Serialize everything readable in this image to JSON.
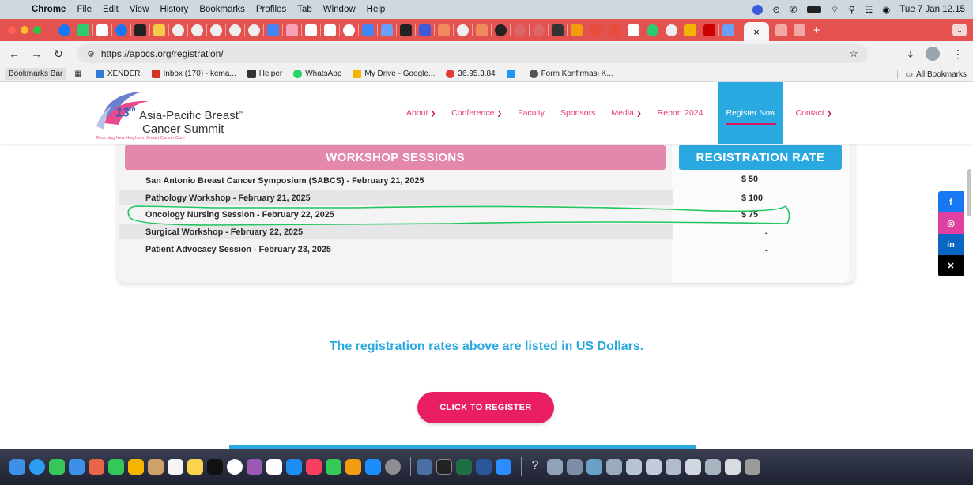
{
  "menubar": {
    "app": "Chrome",
    "items": [
      "File",
      "Edit",
      "View",
      "History",
      "Bookmarks",
      "Profiles",
      "Tab",
      "Window",
      "Help"
    ],
    "clock": "Tue 7 Jan  12.15"
  },
  "browser": {
    "url": "https://apbcs.org/registration/",
    "tab_close": "×",
    "new_tab": "+",
    "bookmarks_label": "Bookmarks Bar",
    "bookmarks": [
      {
        "label": "XENDER",
        "color": "#2e7dd8"
      },
      {
        "label": "Inbox (170) - kema...",
        "color": "#d93025"
      },
      {
        "label": "Helper",
        "color": "#333333"
      },
      {
        "label": "WhatsApp",
        "color": "#25d366"
      },
      {
        "label": "My Drive - Google...",
        "color": "#f4b400"
      },
      {
        "label": "36.95.3.84",
        "color": "#e53935"
      },
      {
        "label": "",
        "color": "#2196f3"
      },
      {
        "label": "Form Konfirmasi K...",
        "color": "#555555"
      }
    ],
    "all_bookmarks": "All Bookmarks"
  },
  "site": {
    "logo": {
      "number": "13",
      "sup": "th",
      "line1": "Asia-Pacific Breast",
      "tm": "™",
      "line2": "Cancer Summit",
      "tagline": "Reaching New Heights in Breast Cancer Care"
    },
    "nav": [
      {
        "label": "About",
        "dropdown": true
      },
      {
        "label": "Conference",
        "dropdown": true
      },
      {
        "label": "Faculty",
        "dropdown": false
      },
      {
        "label": "Sponsors",
        "dropdown": false
      },
      {
        "label": "Media",
        "dropdown": true
      },
      {
        "label": "Report 2024",
        "dropdown": false
      },
      {
        "label": "Register Now",
        "dropdown": false,
        "active": true
      },
      {
        "label": "Contact",
        "dropdown": true
      }
    ],
    "table": {
      "header_sessions": "WORKSHOP SESSIONS",
      "header_rate": "REGISTRATION RATE",
      "rows": [
        {
          "session": "San Antonio Breast Cancer Symposium (SABCS) - February 21, 2025",
          "rate": "$ 50"
        },
        {
          "session": "Pathology Workshop - February 21, 2025",
          "rate": "$ 100"
        },
        {
          "session": "Oncology Nursing Session - February 22, 2025",
          "rate": "$ 75"
        },
        {
          "session": "Surgical Workshop - February 22, 2025",
          "rate": "-"
        },
        {
          "session": "Patient Advocacy Session - February 23, 2025",
          "rate": "-"
        }
      ]
    },
    "note": "The registration rates above are listed in US Dollars.",
    "register_button": "CLICK TO REGISTER",
    "social": [
      {
        "name": "facebook",
        "glyph": "f",
        "color": "#1877f2"
      },
      {
        "name": "instagram",
        "glyph": "◎",
        "color": "#e040a0"
      },
      {
        "name": "linkedin",
        "glyph": "in",
        "color": "#0a66c2"
      },
      {
        "name": "x",
        "glyph": "✕",
        "color": "#000000"
      }
    ]
  },
  "colors": {
    "accent_pink": "#e91e63",
    "accent_blue": "#2aa8e0",
    "annotation": "#22c55e"
  }
}
